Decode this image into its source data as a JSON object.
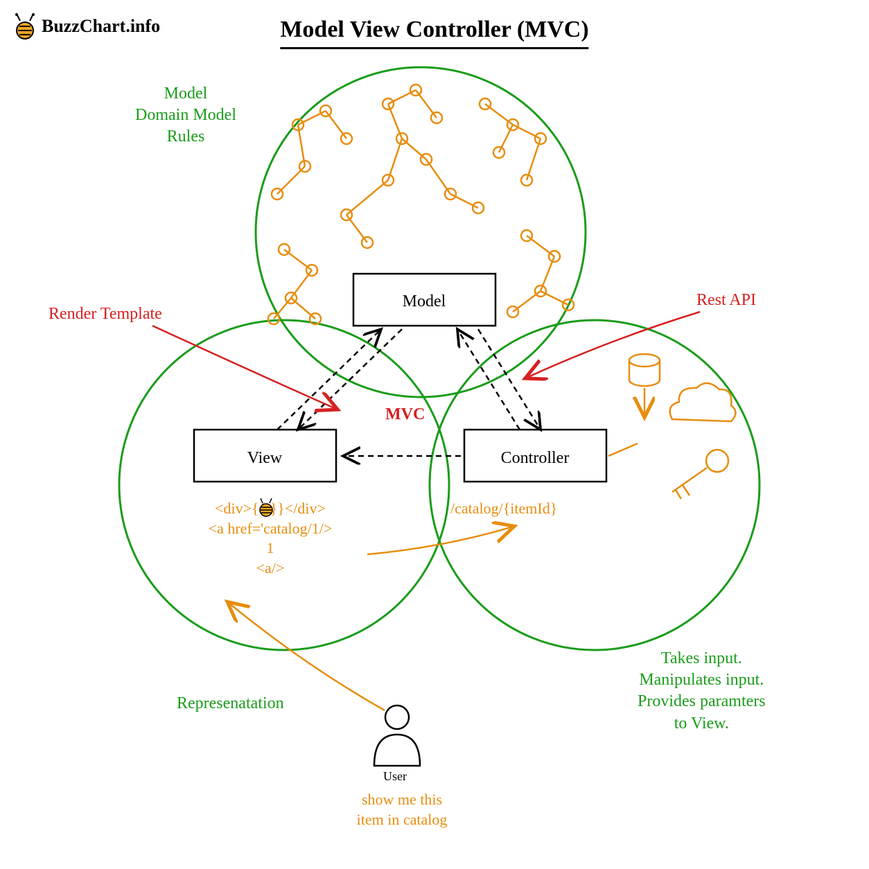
{
  "logo_text": "BuzzChart.info",
  "title": "Model View Controller (MVC)",
  "boxes": {
    "model": "Model",
    "view": "View",
    "controller": "Controller"
  },
  "labels": {
    "model_desc": "Model\nDomain Model\nRules",
    "view_desc": "Represenatation",
    "controller_desc": "Takes input.\nManipulates input.\nProvides paramters\nto View.",
    "render_template": "Render Template",
    "rest_api": "Rest API",
    "mvc_center": "MVC",
    "user": "User",
    "user_action": "show me this\nitem in catalog"
  },
  "code": {
    "div_template": "<div>{{     }}</div>",
    "a_href": "<a href='catalog/1/>",
    "one": "1",
    "a_close": "<a/>",
    "endpoint": "/catalog/{itemId}"
  }
}
